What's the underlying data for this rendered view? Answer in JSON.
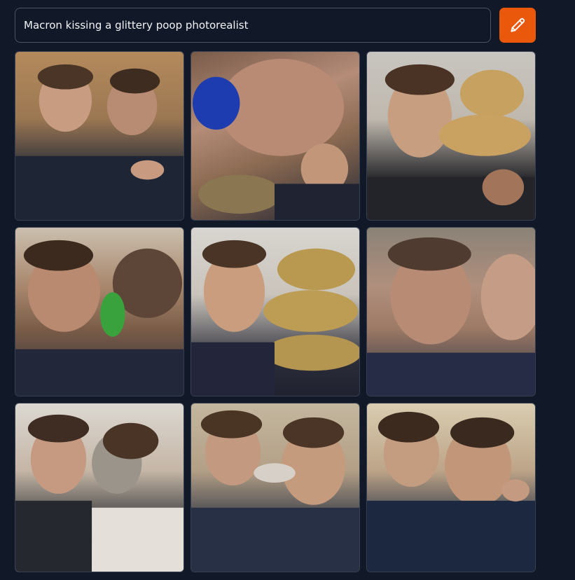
{
  "prompt": {
    "value": "Macron kissing a glittery poop photorealist"
  },
  "actions": {
    "edit_icon": "pencil-icon",
    "accent_color": "#ea580c"
  },
  "results": {
    "count": 9
  },
  "colors": {
    "background": "#111827",
    "input_border": "#4b5563",
    "text": "#f3f4f6"
  }
}
